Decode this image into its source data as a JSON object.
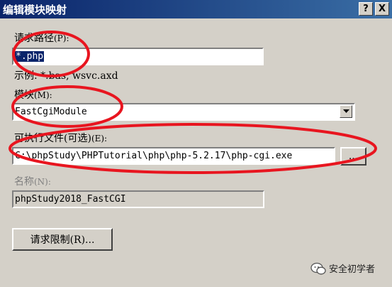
{
  "window": {
    "title": "编辑模块映射",
    "help_glyph": "?",
    "close_glyph": "X"
  },
  "request_path": {
    "label": "请求路径",
    "hotkey": "(P):",
    "value": "*.php",
    "example": "示例: *.bas, wsvc.axd"
  },
  "module": {
    "label": "模块",
    "hotkey": "(M):",
    "value": "FastCgiModule"
  },
  "executable": {
    "label": "可执行文件(可选)",
    "hotkey": "(E):",
    "value": "C:\\phpStudy\\PHPTutorial\\php\\php-5.2.17\\php-cgi.exe",
    "browse_label": "..."
  },
  "name": {
    "label": "名称",
    "hotkey": "(N):",
    "value": "phpStudy2018_FastCGI"
  },
  "restrictions_button": "请求限制(R)...",
  "watermark": {
    "text": "安全初学者",
    "icon": "wechat-icon"
  },
  "colors": {
    "title_bar": "#0a246a",
    "dialog_bg": "#d4d0c8",
    "annotation": "#e8151f"
  }
}
